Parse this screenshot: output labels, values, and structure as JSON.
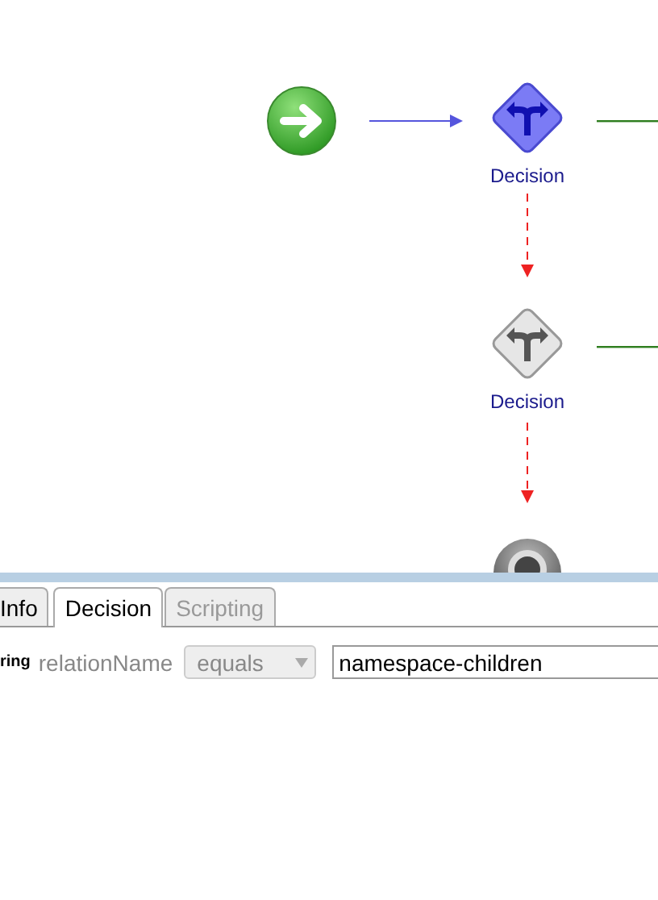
{
  "canvas": {
    "nodes": [
      {
        "kind": "start"
      },
      {
        "kind": "decision",
        "label": "Decision",
        "selected": true
      },
      {
        "kind": "decision",
        "label": "Decision",
        "selected": false
      },
      {
        "kind": "end"
      }
    ],
    "edges": [
      {
        "kind": "solid",
        "color": "#5555dd"
      },
      {
        "kind": "solid",
        "color": "#2e7d1e"
      },
      {
        "kind": "dashed",
        "color": "#ee2222"
      },
      {
        "kind": "solid",
        "color": "#2e7d1e"
      },
      {
        "kind": "dashed",
        "color": "#ee2222"
      }
    ]
  },
  "tabs": [
    {
      "label": "Info",
      "selected": false,
      "disabled": false
    },
    {
      "label": "Decision",
      "selected": true,
      "disabled": false
    },
    {
      "label": "Scripting",
      "selected": false,
      "disabled": true
    }
  ],
  "condition": {
    "cut_label": "ring",
    "field": "relationName",
    "operator": {
      "value": "equals",
      "disabled": true
    },
    "value": "namespace-children"
  }
}
